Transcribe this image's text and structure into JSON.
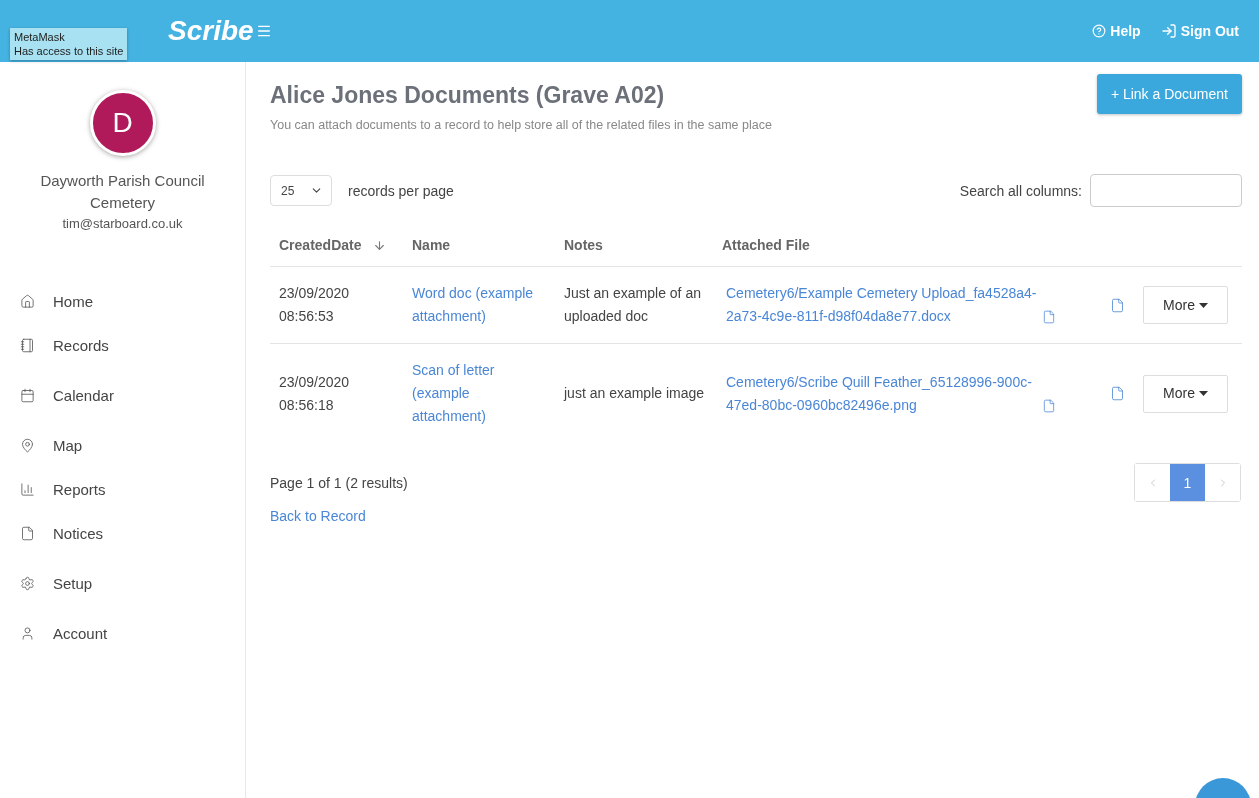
{
  "header": {
    "logo": "Scribe",
    "help": "Help",
    "sign_out": "Sign Out"
  },
  "extension_tooltip": {
    "title": "MetaMask",
    "text": "Has access to this site"
  },
  "profile": {
    "initial": "D",
    "organisation": "Dayworth Parish Council",
    "site": "Cemetery",
    "email": "tim@starboard.co.uk"
  },
  "sidebar": {
    "groups": [
      [
        {
          "label": "Home"
        }
      ],
      [
        {
          "label": "Records"
        },
        {
          "label": "Calendar"
        },
        {
          "label": "Map"
        }
      ],
      [
        {
          "label": "Reports"
        }
      ],
      [
        {
          "label": "Notices"
        },
        {
          "label": "Setup"
        },
        {
          "label": "Account"
        }
      ]
    ]
  },
  "page": {
    "title": "Alice Jones Documents (Grave A02)",
    "subtitle": "You can attach documents to a record to help store all of the related files in the same place",
    "primary_button": "+ Link a Document"
  },
  "table_controls": {
    "page_size": "25",
    "page_size_label": "records per page",
    "search_label": "Search all columns:"
  },
  "table": {
    "columns": [
      "CreatedDate",
      "Name",
      "Notes",
      "Attached File"
    ],
    "rows": [
      {
        "date": "23/09/2020",
        "time": "08:56:53",
        "name": "Word doc (example attachment)",
        "notes": "Just an example of an uploaded doc",
        "file": "Cemetery6/Example Cemetery Upload_fa4528a4-2a73-4c9e-811f-d98f04da8e77.docx",
        "action": "More"
      },
      {
        "date": "23/09/2020",
        "time": "08:56:18",
        "name": "Scan of letter (example attachment)",
        "notes": "just an example image",
        "file": "Cemetery6/Scribe Quill Feather_65128996-900c-47ed-80bc-0960bc82496e.png",
        "action": "More"
      }
    ]
  },
  "footer": {
    "summary": "Page 1 of 1 (2 results)",
    "back_link": "Back to Record",
    "pages": [
      {
        "label": "1",
        "selected": true
      }
    ]
  }
}
